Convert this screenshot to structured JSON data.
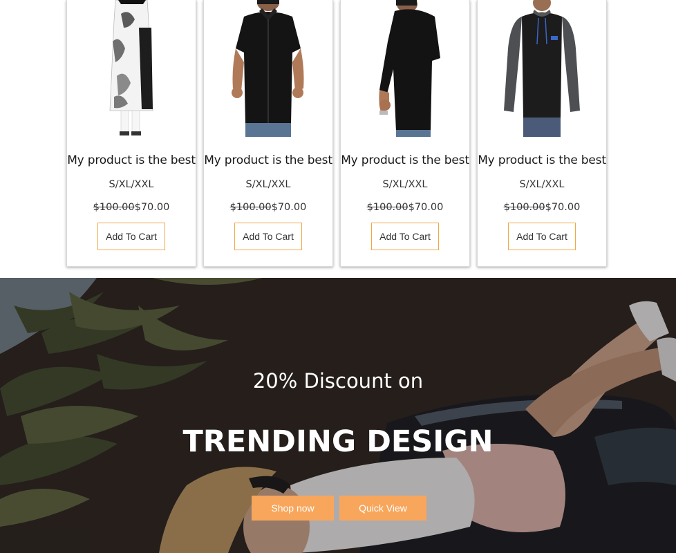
{
  "products": [
    {
      "icon": "kurti-product-image",
      "title": "My product is the best",
      "sizes": "S/XL/XXL",
      "old_price": "$100.00",
      "new_price": "$70.00",
      "cta": "Add To Cart"
    },
    {
      "icon": "black-shirt-product-image",
      "title": "My product is the best",
      "sizes": "S/XL/XXL",
      "old_price": "$100.00",
      "new_price": "$70.00",
      "cta": "Add To Cart"
    },
    {
      "icon": "black-hoodie-product-image",
      "title": "My product is the best",
      "sizes": "S/XL/XXL",
      "old_price": "$100.00",
      "new_price": "$70.00",
      "cta": "Add To Cart"
    },
    {
      "icon": "raglan-hoodie-product-image",
      "title": "My product is the best",
      "sizes": "S/XL/XXL",
      "old_price": "$100.00",
      "new_price": "$70.00",
      "cta": "Add To Cart"
    }
  ],
  "hero": {
    "subtitle": "20% Discount on",
    "title": "TRENDING DESIGN",
    "shop_now": "Shop now",
    "quick_view": "Quick View"
  },
  "colors": {
    "accent": "#f8a65c",
    "button_border": "#f0a844"
  }
}
